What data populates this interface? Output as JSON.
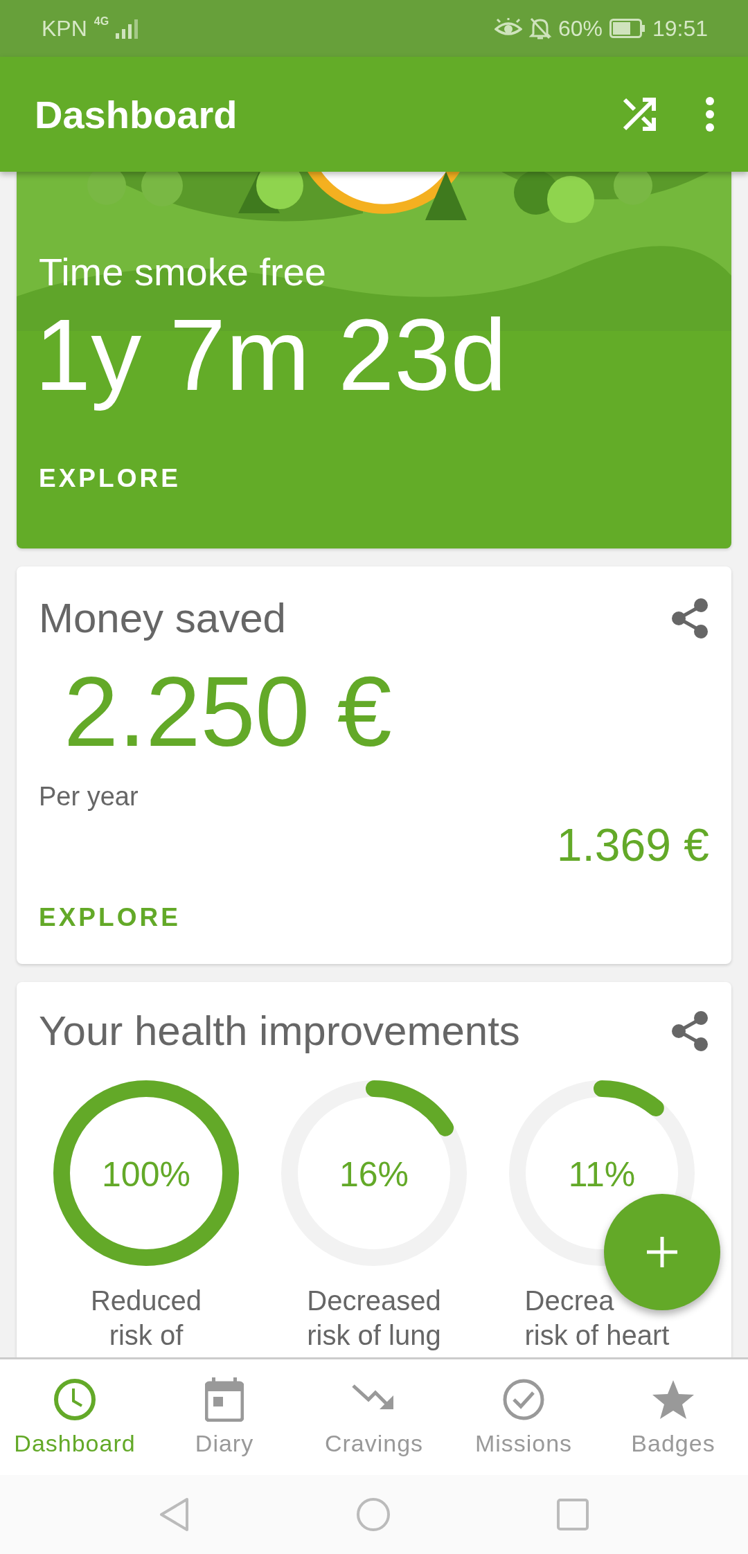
{
  "status_bar": {
    "carrier": "KPN",
    "network": "4G",
    "battery_text": "60%",
    "time": "19:51"
  },
  "app_bar": {
    "title": "Dashboard"
  },
  "smoke_free": {
    "title": "Time smoke free",
    "duration": "1y 7m 23d",
    "action": "EXPLORE"
  },
  "money": {
    "title": "Money saved",
    "amount": "2.250 €",
    "period": "Per year",
    "secondary_amount": "1.369 €",
    "action": "EXPLORE"
  },
  "health": {
    "title": "Your health improvements",
    "items": [
      {
        "percent": "100%",
        "label_line_1": "Reduced",
        "label_line_2": "risk of"
      },
      {
        "percent": "16%",
        "label_line_1": "Decreased",
        "label_line_2": "risk of lung"
      },
      {
        "percent": "11%",
        "label_line_1": "Decrea",
        "label_line_2": "risk of heart"
      }
    ]
  },
  "bottom_nav": [
    {
      "label": "Dashboard",
      "kind": "clock",
      "selected": true
    },
    {
      "label": "Diary",
      "kind": "calendar",
      "selected": false
    },
    {
      "label": "Cravings",
      "kind": "trend",
      "selected": false
    },
    {
      "label": "Missions",
      "kind": "check",
      "selected": false
    },
    {
      "label": "Badges",
      "kind": "star",
      "selected": false
    }
  ]
}
